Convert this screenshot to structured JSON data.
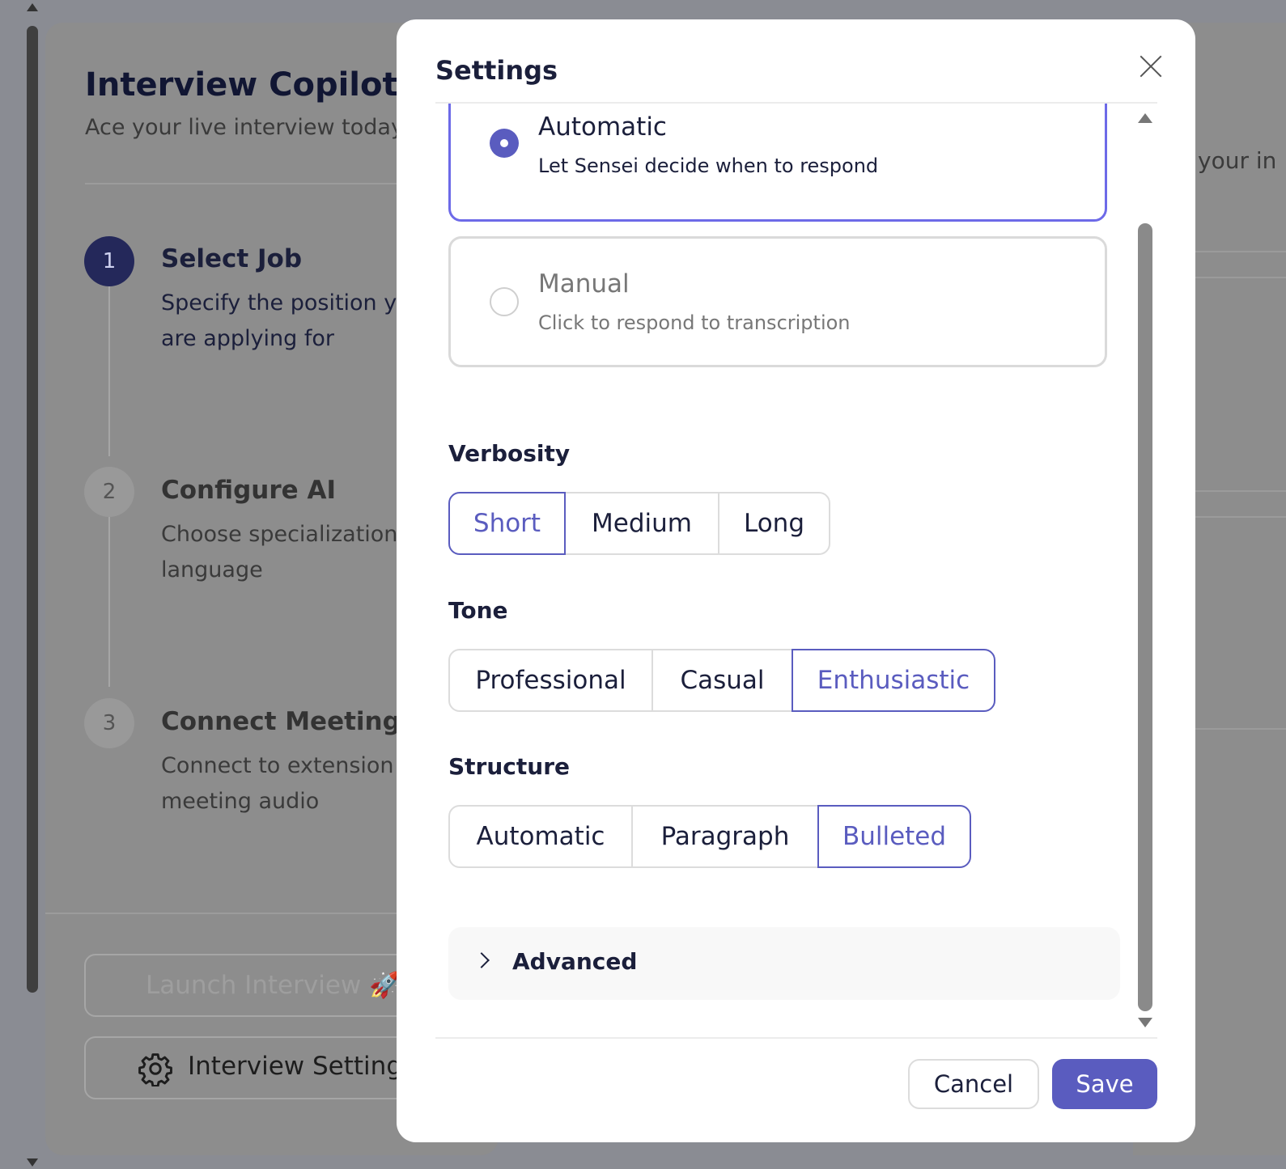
{
  "app": {
    "title": "Interview Copilot",
    "subtitle": "Ace your live interview today"
  },
  "steps": [
    {
      "number": "1",
      "title": "Select Job",
      "desc_line1": "Specify the position you",
      "desc_line2": "are applying for"
    },
    {
      "number": "2",
      "title": "Configure AI",
      "desc_line1": "Choose specialization and",
      "desc_line2": "language"
    },
    {
      "number": "3",
      "title": "Connect Meeting",
      "desc_line1": "Connect to extension for",
      "desc_line2": "meeting audio"
    }
  ],
  "actions": {
    "launch_label": "Launch Interview 🚀",
    "settings_label": "Interview Settings"
  },
  "background_right_text": "your in",
  "modal": {
    "title": "Settings",
    "response_mode": {
      "selected": "Automatic",
      "options": [
        {
          "title": "Automatic",
          "desc": "Let Sensei decide when to respond"
        },
        {
          "title": "Manual",
          "desc": "Click to respond to transcription"
        }
      ]
    },
    "verbosity": {
      "label": "Verbosity",
      "options": [
        "Short",
        "Medium",
        "Long"
      ],
      "selected": "Short"
    },
    "tone": {
      "label": "Tone",
      "options": [
        "Professional",
        "Casual",
        "Enthusiastic"
      ],
      "selected": "Enthusiastic"
    },
    "structure": {
      "label": "Structure",
      "options": [
        "Automatic",
        "Paragraph",
        "Bulleted"
      ],
      "selected": "Bulleted"
    },
    "advanced_label": "Advanced",
    "cancel_label": "Cancel",
    "save_label": "Save"
  },
  "colors": {
    "accent": "#5a5cbf",
    "selected_border": "#6d6ae8",
    "text_dark": "#1b1f3b",
    "overlay": "#8a8c93"
  }
}
